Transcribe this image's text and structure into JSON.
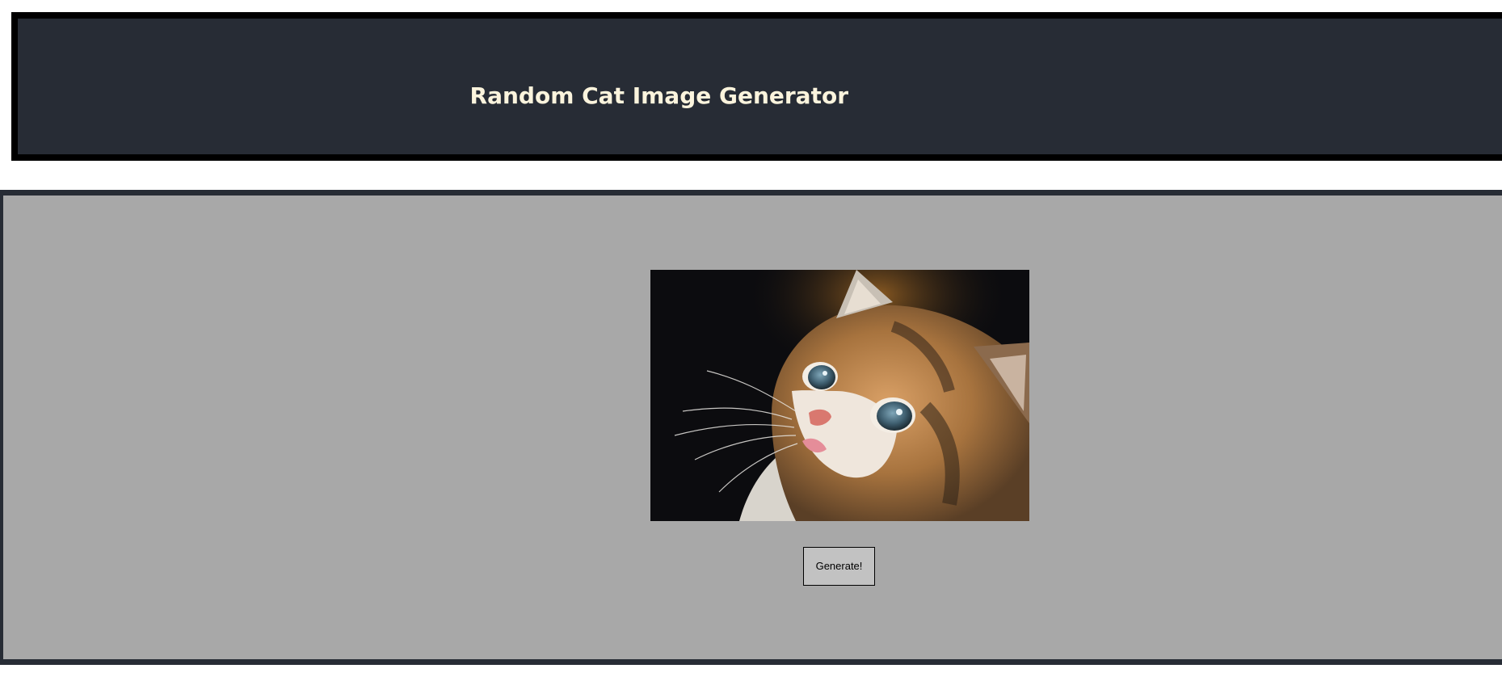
{
  "header": {
    "title": "Random Cat Image Generator"
  },
  "main": {
    "image": {
      "subject": "kitten-photo"
    },
    "generate_label": "Generate!"
  },
  "colors": {
    "header_background": "#272c35",
    "header_border": "#000000",
    "title_text": "#fbf4dd",
    "main_background": "#a8a8a8",
    "main_border": "#272c35",
    "button_background": "#c2c2c2"
  }
}
